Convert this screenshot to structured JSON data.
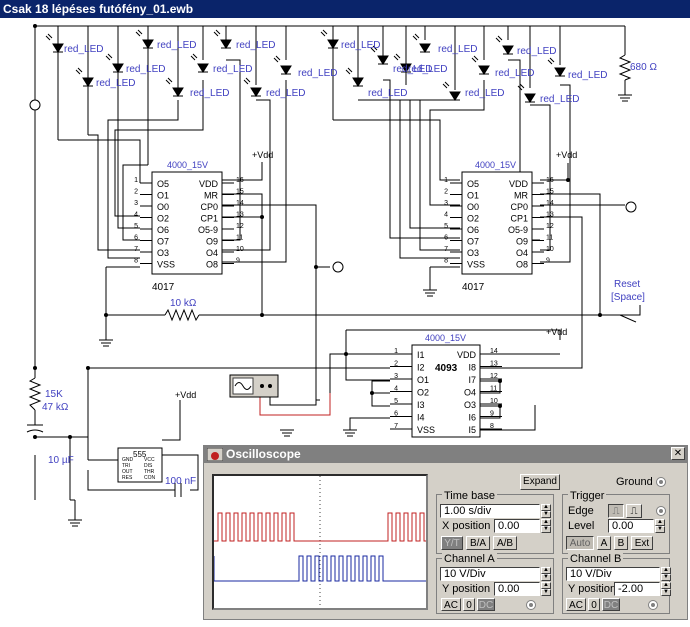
{
  "window": {
    "title": "Csak 18 lépéses futófény_01.ewb"
  },
  "circuit": {
    "led_label": "red_LED",
    "resistor_top": "680 Ω",
    "chip_4017_header": "4000_15V",
    "chip_4017_name": "4017",
    "chip_4017_left_pins": [
      "1",
      "2",
      "3",
      "4",
      "5",
      "6",
      "7",
      "8"
    ],
    "chip_4017_left_names": [
      "O5",
      "O1",
      "O0",
      "O2",
      "O6",
      "O7",
      "O3",
      "VSS"
    ],
    "chip_4017_right_pins": [
      "16",
      "15",
      "14",
      "13",
      "12",
      "11",
      "10",
      "9"
    ],
    "chip_4017_right_names": [
      "VDD",
      "MR",
      "CP0",
      "CP1",
      "O5-9",
      "O9",
      "O4",
      "O8"
    ],
    "vdd_label": "+Vdd",
    "resistor_mid": "10 kΩ",
    "reset_label": "Reset",
    "reset_key": "[Space]",
    "chip_4093_header": "4000_15V",
    "chip_4093_name": "4093",
    "chip_4093_left_pins": [
      "1",
      "2",
      "3",
      "4",
      "5",
      "6",
      "7"
    ],
    "chip_4093_left_names": [
      "I1",
      "I2",
      "O1",
      "O2",
      "I3",
      "I4",
      "VSS"
    ],
    "chip_4093_right_pins": [
      "14",
      "13",
      "12",
      "11",
      "10",
      "9",
      "8"
    ],
    "chip_4093_right_names": [
      "VDD",
      "I8",
      "I7",
      "O4",
      "O3",
      "I6",
      "I5"
    ],
    "resistor_555_a": "15K",
    "resistor_555_b": "47 kΩ",
    "cap_1": "10 µF",
    "cap_2": "100 nF",
    "timer_name": "555",
    "timer_pins_left": [
      "GND",
      "TRI",
      "OUT",
      "RES"
    ],
    "timer_pins_right": [
      "VCC",
      "DIS",
      "THR",
      "CON"
    ]
  },
  "oscilloscope": {
    "title": "Oscilloscope",
    "close": "✕",
    "expand": "Expand",
    "ground": "Ground",
    "timebase": {
      "title": "Time base",
      "value": "1.00 s/div",
      "xpos_label": "X position",
      "xpos": "0.00",
      "modes": [
        "Y/T",
        "B/A",
        "A/B"
      ]
    },
    "trigger": {
      "title": "Trigger",
      "edge": "Edge",
      "level_label": "Level",
      "level": "0.00",
      "buttons": [
        "Auto",
        "A",
        "B",
        "Ext"
      ]
    },
    "channel_a": {
      "title": "Channel A",
      "value": "10  V/Div",
      "ypos_label": "Y position",
      "ypos": "0.00",
      "coupling": [
        "AC",
        "0",
        "DC"
      ]
    },
    "channel_b": {
      "title": "Channel B",
      "value": "10  V/Div",
      "ypos_label": "Y position",
      "ypos": "-2.00",
      "coupling": [
        "AC",
        "0",
        "DC"
      ]
    },
    "colors": {
      "channel_a": "#c02020",
      "channel_b": "#1a2aa0"
    }
  }
}
